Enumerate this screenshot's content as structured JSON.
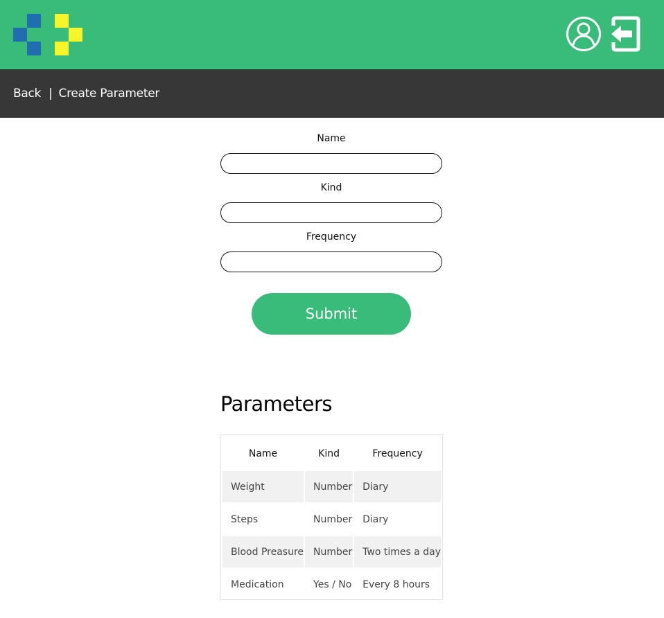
{
  "colors": {
    "accent": "#39bb79",
    "navbar": "#373737",
    "logo_blue": "#1f6fb0",
    "logo_yellow": "#f5f52a"
  },
  "header": {
    "user_icon": "user-circle-icon",
    "logout_icon": "logout-icon"
  },
  "nav": {
    "back": "Back",
    "separator": "|",
    "page": "Create Parameter"
  },
  "form": {
    "name_label": "Name",
    "name_value": "",
    "kind_label": "Kind",
    "kind_value": "",
    "frequency_label": "Frequency",
    "frequency_value": "",
    "submit_label": "Submit"
  },
  "parameters": {
    "title": "Parameters",
    "columns": [
      "Name",
      "Kind",
      "Frequency"
    ],
    "rows": [
      [
        "Weight",
        "Number",
        "Diary"
      ],
      [
        "Steps",
        "Number",
        "Diary"
      ],
      [
        "Blood Preasure",
        "Number",
        "Two times a day"
      ],
      [
        "Medication",
        "Yes / No",
        "Every 8 hours"
      ]
    ]
  }
}
